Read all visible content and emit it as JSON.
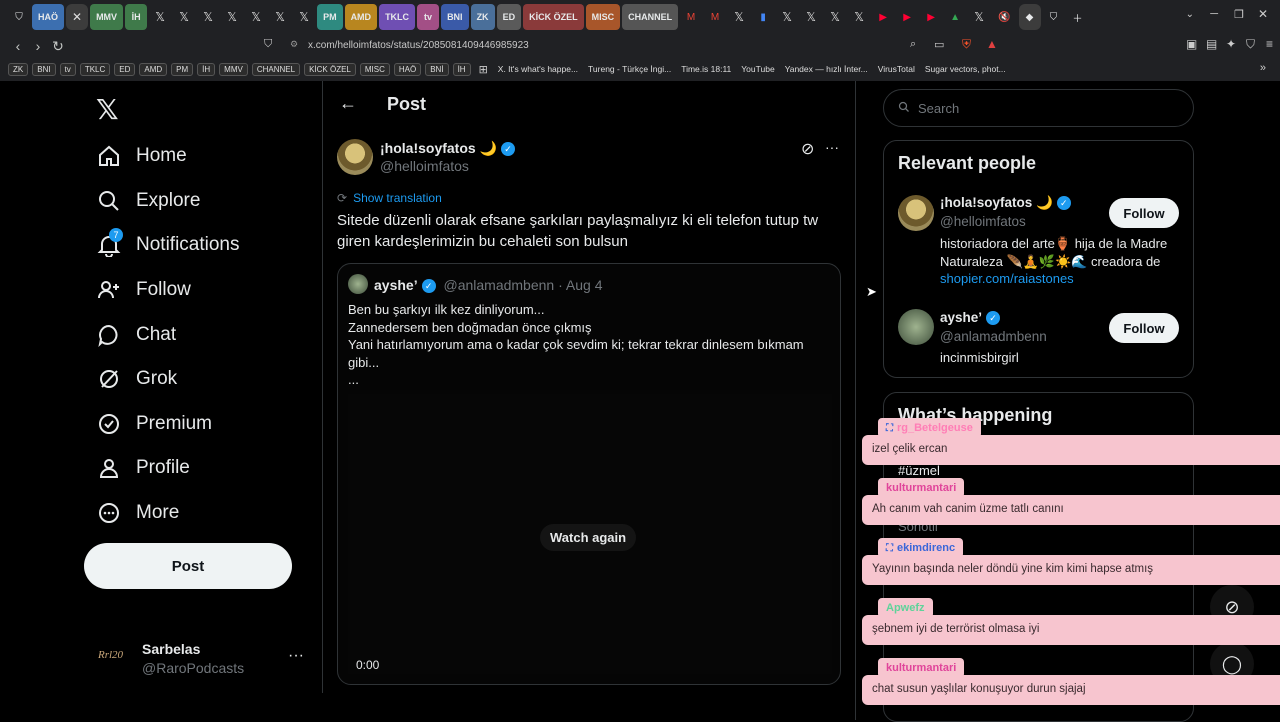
{
  "browser": {
    "tabs": [
      "HAÖ",
      "MMV",
      "İH",
      "PM",
      "AMD",
      "TKLC",
      "tv",
      "BNI",
      "ZK",
      "ED",
      "KİCK ÖZEL",
      "MISC",
      "CHANNEL"
    ],
    "url": "x.com/helloimfatos/status/2085081409446985923",
    "bookmarks_groups": [
      "ZK",
      "BNI",
      "tv",
      "TKLC",
      "ED",
      "AMD",
      "PM",
      "İH",
      "MMV",
      "CHANNEL",
      "KİCK ÖZEL",
      "MISC",
      "HAÖ",
      "BNİ",
      "İH"
    ],
    "bookmark_links": [
      "X. It's what's happe...",
      "Tureng - Türkçe İngi...",
      "Time.is 18:11",
      "YouTube",
      "Yandex — hızlı İnter...",
      "VirusTotal",
      "Sugar vectors, phot..."
    ]
  },
  "sidebar": {
    "items": [
      {
        "label": "Home",
        "icon": "home-icon"
      },
      {
        "label": "Explore",
        "icon": "search-icon"
      },
      {
        "label": "Notifications",
        "icon": "bell-icon"
      },
      {
        "label": "Follow",
        "icon": "follow-icon"
      },
      {
        "label": "Chat",
        "icon": "chat-icon"
      },
      {
        "label": "Grok",
        "icon": "grok-icon"
      },
      {
        "label": "Premium",
        "icon": "premium-icon"
      },
      {
        "label": "Profile",
        "icon": "profile-icon"
      },
      {
        "label": "More",
        "icon": "more-icon"
      }
    ],
    "notif_badge": "7",
    "post_label": "Post",
    "account": {
      "name": "Sarbelas",
      "handle": "@RaroPodcasts",
      "logo": "Rrl20"
    }
  },
  "main": {
    "header_title": "Post",
    "tweet": {
      "name": "¡hola!soyfatos 🌙",
      "handle": "@helloimfatos",
      "show_translation": "Show translation",
      "text": "Sitede düzenli olarak efsane şarkıları paylaşmalıyız ki eli telefon tutup tw giren kardeşlerimizin bu cehaleti son bulsun"
    },
    "quote": {
      "name": "ayshe’",
      "handle": "@anlamadmbenn",
      "date": "· Aug 4",
      "lines": [
        "Ben bu şarkıyı ilk kez dinliyorum...",
        "Zannedersem ben doğmadan önce çıkmış",
        "Yani hatırlamıyorum ama o kadar çok sevdim ki; tekrar tekrar dinlesem bıkmam gibi...",
        "..."
      ],
      "watch_again": "Watch again",
      "time": "0:00"
    }
  },
  "right": {
    "search_placeholder": "Search",
    "relevant_title": "Relevant people",
    "people": [
      {
        "name": "¡hola!soyfatos 🌙",
        "handle": "@helloimfatos",
        "bio": "historiadora del arte🏺 hija de la Madre Naturaleza 🪶🧘🌿☀️🌊 creadora de ",
        "link": "shopier.com/raiastones",
        "follow": "Follow"
      },
      {
        "name": "ayshe’",
        "handle": "@anlamadmbenn",
        "bio": "incinmisbirgirl",
        "follow": "Follow"
      }
    ],
    "happening_title": "What’s happening",
    "trend_partial": "#üzmel",
    "trend_partial2": "Sohotil"
  },
  "chat_overlay": [
    {
      "user": "rg_Betelgeuse",
      "msg": "izel çelik ercan",
      "color": "#ff7eb6",
      "badge": true
    },
    {
      "user": "kulturmantari",
      "msg": "Ah canım vah canim üzme tatlı canını",
      "color": "#e0449a",
      "badge": false
    },
    {
      "user": "ekimdirenc",
      "msg": "Yayının başında neler döndü yine kim kimi hapse atmış",
      "color": "#3b66d8",
      "badge": true
    },
    {
      "user": "Apwefz",
      "msg": "şebnem iyi de terrörist olmasa iyi",
      "color": "#5ed39a",
      "badge": false
    },
    {
      "user": "kulturmantari",
      "msg": "chat susun yaşlılar konuşuyor durun sjajaj",
      "color": "#e0449a",
      "badge": false
    }
  ],
  "colors": {
    "accent": "#1d9bf0",
    "chat_bg": "#f7c5cf"
  }
}
